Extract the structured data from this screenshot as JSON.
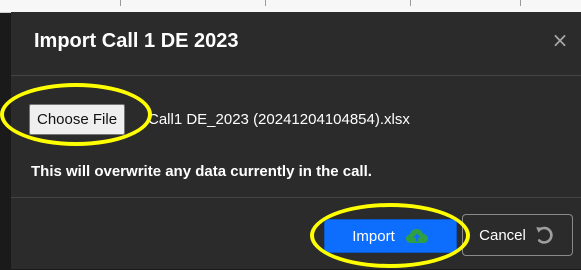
{
  "dialog": {
    "title": "Import Call 1 DE 2023",
    "close_glyph": "×",
    "choose_file_label": "Choose File",
    "file_name": "Call1 DE_2023 (20241204104854).xlsx",
    "warning": "This will overwrite any data currently in the call.",
    "import_label": "Import",
    "cancel_label": "Cancel"
  },
  "icons": {
    "import": "cloud-upload-icon",
    "cancel": "undo-icon",
    "close": "close-icon"
  },
  "colors": {
    "dialog_background": "#2b2b2b",
    "primary_button": "#0d6efd",
    "cloud_icon": "#2ea043",
    "highlight": "#ffff00"
  }
}
